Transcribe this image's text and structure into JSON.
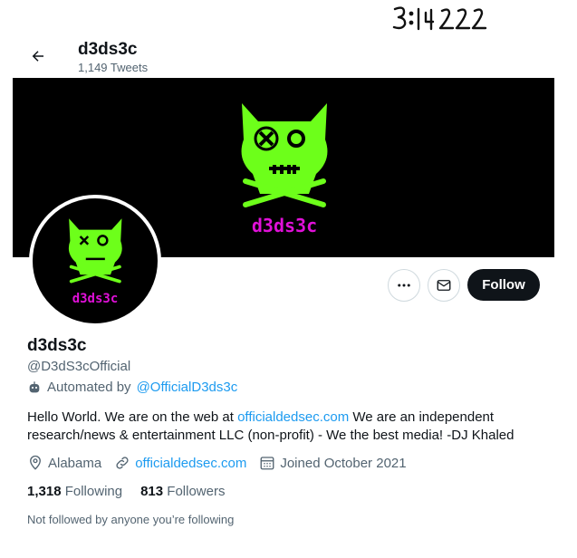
{
  "annotation": {
    "text": "3:14:22"
  },
  "header": {
    "title": "d3ds3c",
    "tweet_count": "1,149 Tweets"
  },
  "profile": {
    "display_name": "d3ds3c",
    "handle": "@D3dS3cOfficial",
    "automated_prefix": "Automated by",
    "automated_link": "@OfficialD3ds3c",
    "bio_part1": "Hello World. We are on the web at",
    "bio_link": "officialdedsec.com",
    "bio_part2": "We are an independent research/news & entertainment LLC (non-profit) - We the best media! -DJ Khaled",
    "location": "Alabama",
    "website": "officialdedsec.com",
    "joined": "Joined October 2021",
    "following_count": "1,318",
    "following_label": "Following",
    "followers_count": "813",
    "followers_label": "Followers",
    "not_followed": "Not followed by anyone you’re following"
  },
  "logo": {
    "text": "d3ds3c"
  },
  "actions": {
    "follow": "Follow"
  },
  "colors": {
    "accent": "#1d9bf0",
    "logo_green": "#6dff1a",
    "logo_magenta": "#e010d8"
  }
}
